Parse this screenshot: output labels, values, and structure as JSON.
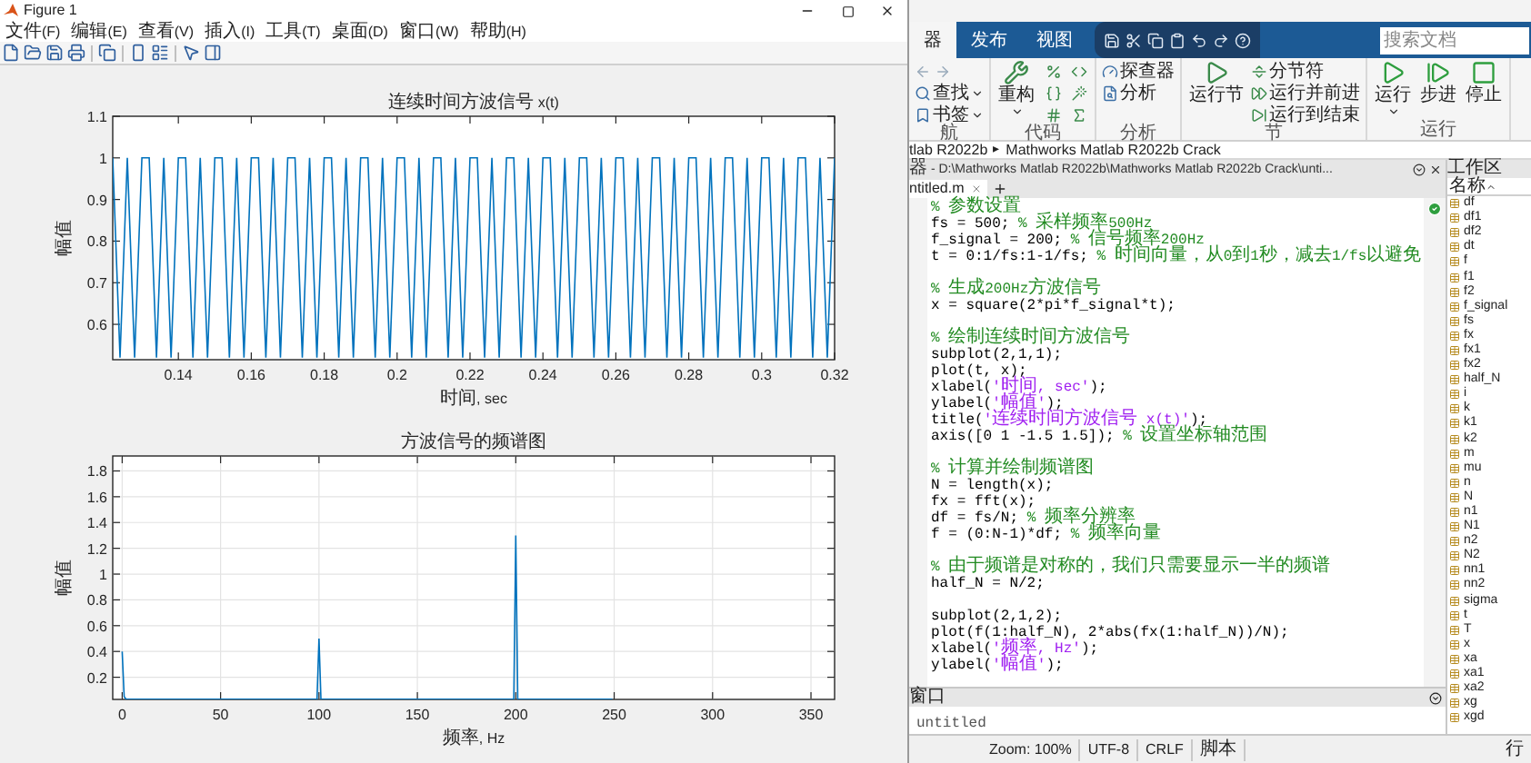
{
  "figure": {
    "title": "Figure 1",
    "menu": [
      "文件(F)",
      "编辑(E)",
      "查看(V)",
      "插入(I)",
      "工具(T)",
      "桌面(D)",
      "窗口(W)",
      "帮助(H)"
    ],
    "plots": [
      {
        "chart_data": {
          "grid": false,
          "type": "line",
          "title": "连续时间方波信号 x(t)",
          "xlabel": "时间, sec",
          "ylabel": "幅值",
          "xlim": [
            0.122,
            0.32
          ],
          "ylim": [
            0.515,
            1.1
          ],
          "xticks": [
            0.14,
            0.16,
            0.18,
            0.2,
            0.22,
            0.24,
            0.26,
            0.28,
            0.3,
            0.32
          ],
          "yticks": [
            0.6,
            0.7,
            0.8,
            0.9,
            1,
            1.1
          ],
          "x": [
            0.122,
            0.124,
            0.126,
            0.128,
            0.13,
            0.132,
            0.134,
            0.136,
            0.138,
            0.14,
            0.142,
            0.144,
            0.146,
            0.148,
            0.15,
            0.152,
            0.154,
            0.156,
            0.158,
            0.16,
            0.162,
            0.164,
            0.166,
            0.168,
            0.17,
            0.172,
            0.174,
            0.176,
            0.178,
            0.18,
            0.182,
            0.184,
            0.186,
            0.188,
            0.19,
            0.192,
            0.194,
            0.196,
            0.198,
            0.2,
            0.202,
            0.204,
            0.206,
            0.208,
            0.21,
            0.212,
            0.214,
            0.216,
            0.218,
            0.22,
            0.222,
            0.224,
            0.226,
            0.228,
            0.23,
            0.232,
            0.234,
            0.236,
            0.238,
            0.24,
            0.242,
            0.244,
            0.246,
            0.248,
            0.25,
            0.252,
            0.254,
            0.256,
            0.258,
            0.26,
            0.262,
            0.264,
            0.266,
            0.268,
            0.27,
            0.272,
            0.274,
            0.276,
            0.278,
            0.28,
            0.282,
            0.284,
            0.286,
            0.288,
            0.29,
            0.292,
            0.294,
            0.296,
            0.298,
            0.3,
            0.302,
            0.304,
            0.306,
            0.308,
            0.31,
            0.312,
            0.314,
            0.316,
            0.318,
            0.32
          ],
          "series": [
            {
              "color": "#0072bd",
              "values": [
                1,
                0.52,
                1,
                0.52,
                1,
                1,
                0.52,
                1,
                0.52,
                1,
                1,
                0.52,
                1,
                0.52,
                1,
                1,
                0.52,
                1,
                0.52,
                1,
                1,
                0.52,
                1,
                0.52,
                1,
                1,
                0.52,
                1,
                0.52,
                1,
                1,
                0.52,
                1,
                0.52,
                1,
                1,
                0.52,
                1,
                0.52,
                1,
                1,
                0.52,
                1,
                0.52,
                1,
                1,
                0.52,
                1,
                0.52,
                1,
                1,
                0.52,
                1,
                0.52,
                1,
                1,
                0.52,
                1,
                0.52,
                1,
                1,
                0.52,
                1,
                0.52,
                1,
                1,
                0.52,
                1,
                0.52,
                1,
                1,
                0.52,
                1,
                0.52,
                1,
                1,
                0.52,
                1,
                0.52,
                1,
                1,
                0.52,
                1,
                0.52,
                1,
                1,
                0.52,
                1,
                0.52,
                1,
                1,
                0.52,
                1,
                0.52,
                1,
                1,
                0.52,
                1,
                0.52,
                1
              ]
            }
          ]
        }
      },
      {
        "chart_data": {
          "grid": true,
          "type": "line",
          "title": "方波信号的频谱图",
          "xlabel": "频率, Hz",
          "ylabel": "幅值",
          "xlim": [
            -4.8,
            362
          ],
          "ylim": [
            0.028,
            1.916
          ],
          "xticks": [
            0,
            50,
            100,
            150,
            200,
            250,
            300,
            350
          ],
          "yticks": [
            0.2,
            0.4,
            0.6,
            0.8,
            1,
            1.2,
            1.4,
            1.6,
            1.8
          ],
          "x": [
            0,
            1,
            2,
            99,
            100,
            101,
            199,
            200,
            201,
            249
          ],
          "series": [
            {
              "color": "#0072bd",
              "values": [
                0.4,
                0.05,
                0.03,
                0.03,
                0.5,
                0.03,
                0.03,
                1.3,
                0.03,
                0.03
              ]
            }
          ]
        }
      }
    ]
  },
  "ribbon": {
    "tabs": [
      {
        "label": "器",
        "selected": true
      },
      {
        "label": "发布",
        "selected": false
      },
      {
        "label": "视图",
        "selected": false
      }
    ],
    "search": {
      "placeholder": "搜索文档"
    },
    "groups": [
      {
        "label": "航",
        "items": [
          {
            "kind": "history"
          },
          {
            "kind": "small",
            "label": "查找",
            "dropdown": true
          },
          {
            "kind": "small",
            "label": "书签",
            "dropdown": true
          }
        ]
      },
      {
        "label": "代码",
        "items": [
          {
            "kind": "large",
            "label": "重构",
            "dropdown": true
          },
          {
            "kind": "icon"
          },
          {
            "kind": "icon"
          },
          {
            "kind": "icon"
          },
          {
            "kind": "icon"
          },
          {
            "kind": "icon"
          },
          {
            "kind": "icon"
          }
        ]
      },
      {
        "label": "分析",
        "items": [
          {
            "kind": "small",
            "label": "探查器",
            "dropdown": false
          },
          {
            "kind": "small",
            "label": "分析",
            "dropdown": false
          }
        ]
      },
      {
        "label": "节",
        "items": [
          {
            "kind": "large",
            "label": "运行节",
            "dropdown": false
          },
          {
            "kind": "small",
            "label": "分节符",
            "dropdown": false
          },
          {
            "kind": "small",
            "label": "运行并前进",
            "dropdown": false
          },
          {
            "kind": "small",
            "label": "运行到结束",
            "dropdown": false
          }
        ]
      },
      {
        "label": "运行",
        "items": [
          {
            "kind": "large",
            "label": "运行",
            "dropdown": true
          },
          {
            "kind": "large",
            "label": "步进",
            "dropdown": false
          },
          {
            "kind": "large",
            "label": "停止",
            "dropdown": false
          }
        ]
      }
    ]
  },
  "breadcrumb": {
    "separator": "▸",
    "parts": [
      "tlab R2022b",
      "Mathworks Matlab R2022b Crack"
    ]
  },
  "editor": {
    "path": "器 - D:\\Mathworks Matlab R2022b\\Mathworks Matlab R2022b Crack\\unti...",
    "tab": "ntitled.m",
    "lines": [
      {
        "kind": "code",
        "segments": [
          {
            "kind": "comment",
            "text": "% 参数设置"
          }
        ]
      },
      {
        "kind": "code",
        "segments": [
          {
            "kind": "code",
            "text": "fs = 500; "
          },
          {
            "kind": "comment",
            "text": "% 采样频率500Hz"
          }
        ]
      },
      {
        "kind": "code",
        "segments": [
          {
            "kind": "code",
            "text": "f_signal = 200; "
          },
          {
            "kind": "comment",
            "text": "% 信号频率200Hz"
          }
        ]
      },
      {
        "kind": "code",
        "segments": [
          {
            "kind": "code",
            "text": "t = 0:1/fs:1-1/fs; "
          },
          {
            "kind": "comment",
            "text": "% 时间向量，从0到1秒，减去1/fs以避免"
          }
        ]
      },
      {
        "kind": "blank"
      },
      {
        "kind": "code",
        "segments": [
          {
            "kind": "comment",
            "text": "% 生成200Hz方波信号"
          }
        ]
      },
      {
        "kind": "code",
        "segments": [
          {
            "kind": "code",
            "text": "x = square(2*pi*f_signal*t);"
          }
        ]
      },
      {
        "kind": "blank"
      },
      {
        "kind": "code",
        "segments": [
          {
            "kind": "comment",
            "text": "% 绘制连续时间方波信号"
          }
        ]
      },
      {
        "kind": "code",
        "segments": [
          {
            "kind": "code",
            "text": "subplot(2,1,1);"
          }
        ]
      },
      {
        "kind": "code",
        "segments": [
          {
            "kind": "code",
            "text": "plot(t, x);"
          }
        ]
      },
      {
        "kind": "code",
        "segments": [
          {
            "kind": "code",
            "text": "xlabel("
          },
          {
            "kind": "string",
            "text": "'时间, sec'"
          },
          {
            "kind": "code",
            "text": ");"
          }
        ]
      },
      {
        "kind": "code",
        "segments": [
          {
            "kind": "code",
            "text": "ylabel("
          },
          {
            "kind": "string",
            "text": "'幅值'"
          },
          {
            "kind": "code",
            "text": ");"
          }
        ]
      },
      {
        "kind": "code",
        "segments": [
          {
            "kind": "code",
            "text": "title("
          },
          {
            "kind": "string",
            "text": "'连续时间方波信号 x(t)'"
          },
          {
            "kind": "code",
            "text": ");"
          }
        ]
      },
      {
        "kind": "code",
        "segments": [
          {
            "kind": "code",
            "text": "axis([0 1 -1.5 1.5]); "
          },
          {
            "kind": "comment",
            "text": "% 设置坐标轴范围"
          }
        ]
      },
      {
        "kind": "blank"
      },
      {
        "kind": "code",
        "segments": [
          {
            "kind": "comment",
            "text": "% 计算并绘制频谱图"
          }
        ]
      },
      {
        "kind": "code",
        "segments": [
          {
            "kind": "code",
            "text": "N = length(x);"
          }
        ]
      },
      {
        "kind": "code",
        "segments": [
          {
            "kind": "code",
            "text": "fx = fft(x);"
          }
        ]
      },
      {
        "kind": "code",
        "segments": [
          {
            "kind": "code",
            "text": "df = fs/N; "
          },
          {
            "kind": "comment",
            "text": "% 频率分辨率"
          }
        ]
      },
      {
        "kind": "code",
        "segments": [
          {
            "kind": "code",
            "text": "f = (0:N-1)*df; "
          },
          {
            "kind": "comment",
            "text": "% 频率向量"
          }
        ]
      },
      {
        "kind": "blank"
      },
      {
        "kind": "code",
        "segments": [
          {
            "kind": "comment",
            "text": "% 由于频谱是对称的，我们只需要显示一半的频谱"
          }
        ]
      },
      {
        "kind": "code",
        "segments": [
          {
            "kind": "code",
            "text": "half_N = N/2;"
          }
        ]
      },
      {
        "kind": "blank"
      },
      {
        "kind": "code",
        "segments": [
          {
            "kind": "code",
            "text": "subplot(2,1,2);"
          }
        ]
      },
      {
        "kind": "code",
        "segments": [
          {
            "kind": "code",
            "text": "plot(f(1:half_N), 2*abs(fx(1:half_N))/N);"
          }
        ]
      },
      {
        "kind": "code",
        "segments": [
          {
            "kind": "code",
            "text": "xlabel("
          },
          {
            "kind": "string",
            "text": "'频率, Hz'"
          },
          {
            "kind": "code",
            "text": ");"
          }
        ]
      },
      {
        "kind": "code",
        "segments": [
          {
            "kind": "code",
            "text": "ylabel("
          },
          {
            "kind": "string",
            "text": "'幅值'"
          },
          {
            "kind": "code",
            "text": ");"
          }
        ]
      }
    ]
  },
  "command_window": {
    "title": "窗口",
    "text": "untitled"
  },
  "workspace": {
    "title": "工作区",
    "column": "名称",
    "variables": [
      "df",
      "df1",
      "df2",
      "dt",
      "f",
      "f1",
      "f2",
      "f_signal",
      "fs",
      "fx",
      "fx1",
      "fx2",
      "half_N",
      "i",
      "k",
      "k1",
      "k2",
      "m",
      "mu",
      "n",
      "N",
      "n1",
      "N1",
      "n2",
      "N2",
      "nn1",
      "nn2",
      "sigma",
      "t",
      "T",
      "x",
      "xa",
      "xa1",
      "xa2",
      "xg",
      "xgd"
    ]
  },
  "status_bar": [
    "Zoom: 100%",
    "UTF-8",
    "CRLF",
    "脚本",
    "行"
  ]
}
